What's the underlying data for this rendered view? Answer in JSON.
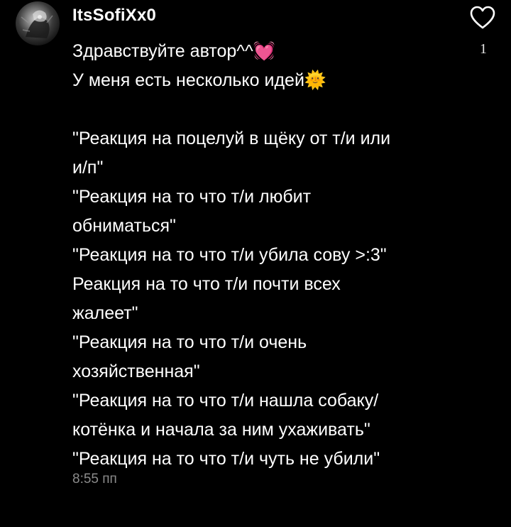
{
  "comment": {
    "author": "ItsSofiXx0",
    "lines": [
      "Здравствуйте автор^^💓",
      "У меня есть несколько идей🌞",
      "",
      "\"Реакция на поцелуй в щёку от т/и или",
      "и/п\"",
      "\"Реакция на то что т/и любит",
      "обниматься\"",
      "\"Реакция на то что т/и убила сову >:3\"",
      "Реакция на то что т/и почти всех",
      "жалеет\"",
      "\"Реакция на то что т/и очень",
      "хозяйственная\"",
      "\"Реакция на то что т/и нашла собаку/",
      "котёнка и начала за ним ухаживать\"",
      "\"Реакция на то что т/и чуть не убили\""
    ],
    "timestamp": "8:55 пп",
    "likes": "1",
    "like_icon": "heart-outline-icon",
    "colors": {
      "background": "#000000",
      "text": "#ffffff",
      "timestamp": "#8b8b8b"
    }
  }
}
